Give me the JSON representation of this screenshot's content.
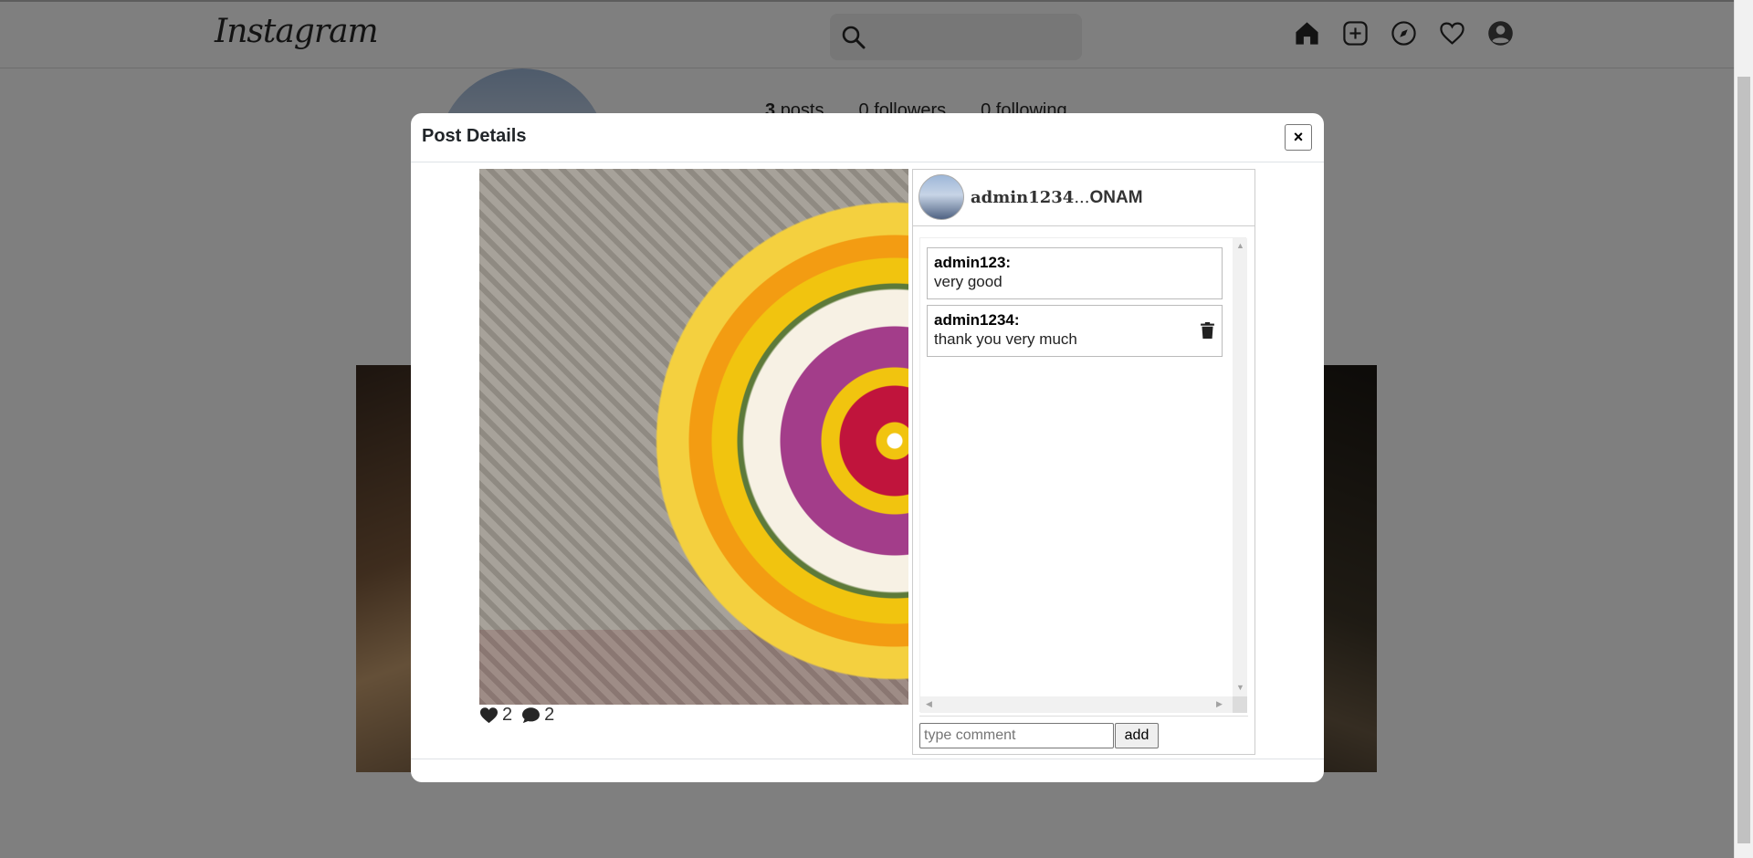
{
  "nav": {
    "logo": "Instagram",
    "search_placeholder": ""
  },
  "profile": {
    "posts_count": "3",
    "posts_label": "posts",
    "followers_count": "0",
    "followers_label": "followers",
    "following_count": "0",
    "following_label": "following"
  },
  "modal": {
    "title": "Post Details",
    "close_label": "×",
    "post": {
      "likes": "2",
      "comments_count": "2"
    },
    "side": {
      "username": "admin1234",
      "separator": "...",
      "caption": "ONAM"
    },
    "comments": [
      {
        "user": "admin123:",
        "text": "very good",
        "deletable": false
      },
      {
        "user": "admin1234:",
        "text": "thank you very much",
        "deletable": true
      }
    ],
    "comment_input_placeholder": "type comment",
    "add_label": "add"
  }
}
